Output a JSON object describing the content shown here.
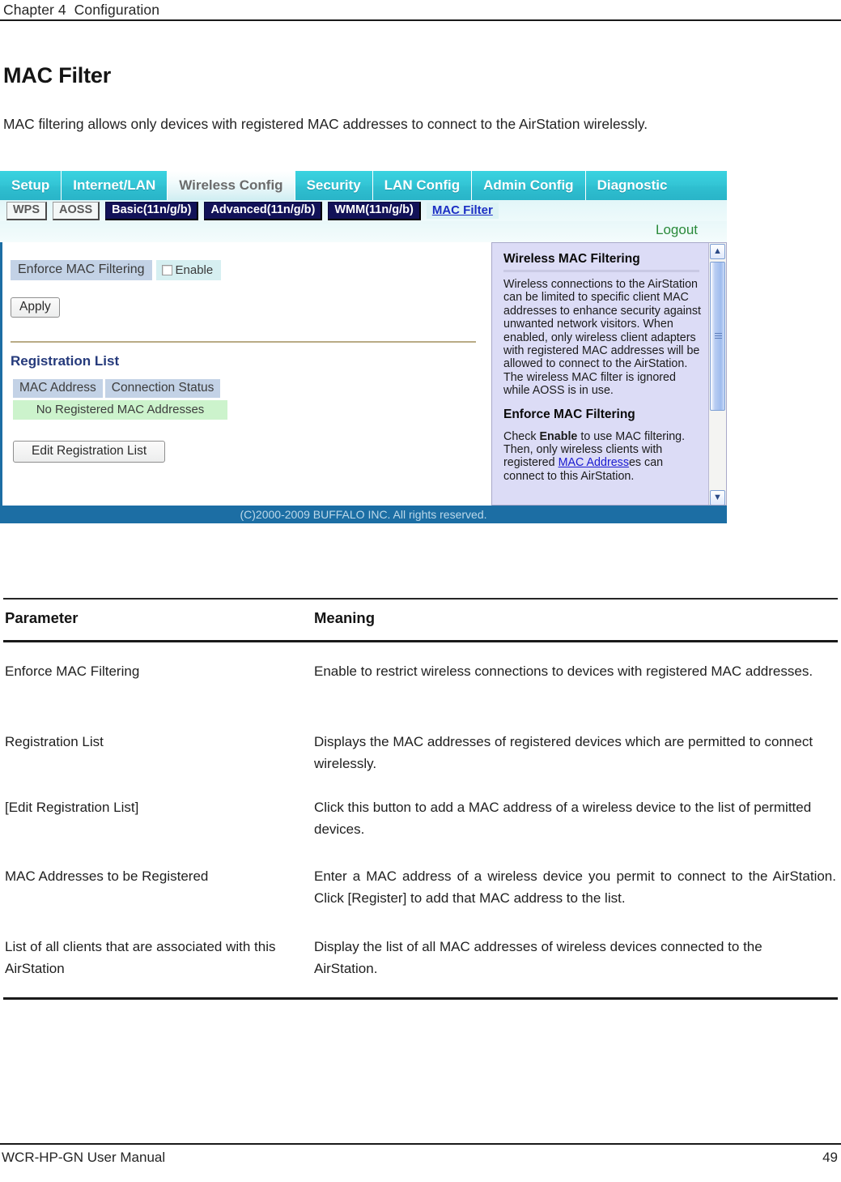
{
  "page": {
    "chapter": "Chapter 4  Configuration",
    "title": "MAC Filter",
    "intro": "MAC filtering allows only devices with registered MAC addresses to connect to the AirStation wirelessly.",
    "footer_manual": "WCR-HP-GN User Manual",
    "footer_pageno": "49"
  },
  "screenshot": {
    "nav": [
      {
        "label": "Setup",
        "active": false
      },
      {
        "label": "Internet/LAN",
        "active": false
      },
      {
        "label": "Wireless Config",
        "active": true
      },
      {
        "label": "Security",
        "active": false
      },
      {
        "label": "LAN Config",
        "active": false
      },
      {
        "label": "Admin Config",
        "active": false
      },
      {
        "label": "Diagnostic",
        "active": false
      }
    ],
    "subnav": [
      {
        "label": "WPS",
        "style": "plain"
      },
      {
        "label": "AOSS",
        "style": "plain"
      },
      {
        "label": "Basic(11n/g/b)",
        "style": "dark"
      },
      {
        "label": "Advanced(11n/g/b)",
        "style": "dark"
      },
      {
        "label": "WMM(11n/g/b)",
        "style": "dark"
      },
      {
        "label": "MAC Filter",
        "style": "current"
      }
    ],
    "logout_label": "Logout",
    "form": {
      "enforce_label": "Enforce MAC Filtering",
      "enable_label": "Enable",
      "enable_checked": false,
      "apply_label": "Apply"
    },
    "registration": {
      "section_title": "Registration List",
      "columns": [
        "MAC Address",
        "Connection Status"
      ],
      "empty_message": "No Registered MAC Addresses",
      "edit_button_label": "Edit Registration List"
    },
    "help": {
      "heading1": "Wireless MAC Filtering",
      "body1": "Wireless connections to the AirStation can be limited to specific client MAC addresses to enhance security against unwanted network visitors. When enabled, only wireless client adapters with registered MAC addresses will be allowed to connect to the AirStation. The wireless MAC filter is ignored while AOSS is in use.",
      "heading2": "Enforce MAC Filtering",
      "body2_pre": "Check ",
      "body2_bold": "Enable",
      "body2_mid": " to use MAC filtering. Then, only wireless clients with registered ",
      "body2_link": "MAC Address",
      "body2_post": "es can connect to this AirStation."
    },
    "copyright": "(C)2000-2009 BUFFALO INC. All rights reserved.",
    "colors": {
      "nav_cyan": "#34c6d6",
      "footer_blue": "#1c6ea4",
      "label_cell": "#c3d2e6",
      "value_cell": "#d6eff1",
      "empty_row_green": "#ccf3cc",
      "help_panel": "#dcdcf6",
      "section_title_blue": "#253a7b",
      "logout_green": "#2a8a3a",
      "link_blue": "#1b2ec4",
      "divider_tan": "#b9ab86"
    }
  },
  "table": {
    "header": {
      "parameter": "Parameter",
      "meaning": "Meaning"
    },
    "rows": [
      {
        "parameter": "Enforce MAC Filtering",
        "meaning": "Enable to restrict wireless connections to devices with registered MAC addresses."
      },
      {
        "parameter": "Registration List",
        "meaning": "Displays the MAC addresses of registered devices which are permitted to connect wirelessly."
      },
      {
        "parameter": "[Edit Registration List]",
        "meaning": "Click this button to add a MAC address of a wireless device to the list of permitted devices."
      },
      {
        "parameter": "MAC Addresses to be Registered",
        "meaning": "Enter a MAC address of a wireless device you permit to connect to the AirStation. Click [Register] to add that MAC address to the list."
      },
      {
        "parameter": "List of all clients that are associated with this AirStation",
        "meaning": "Display the list of all MAC addresses of wireless devices connected to the AirStation."
      }
    ]
  }
}
